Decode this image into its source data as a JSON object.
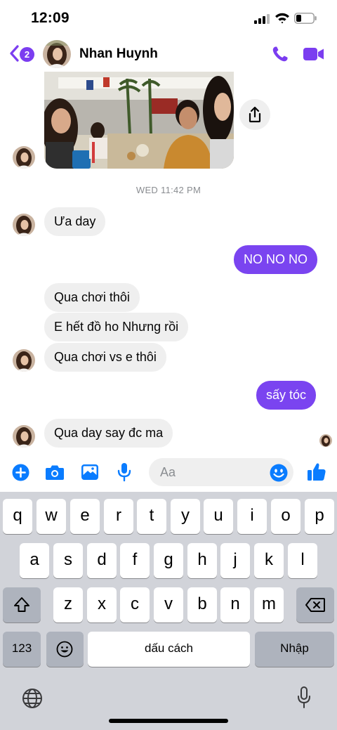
{
  "status_bar": {
    "time": "12:09"
  },
  "header": {
    "unread_count": "2",
    "contact_name": "Nhan Huynh"
  },
  "conversation": {
    "timestamp": "WED 11:42 PM",
    "messages": [
      {
        "sender": "contact",
        "text": "Ưa day"
      },
      {
        "sender": "me",
        "text": "NO NO NO"
      },
      {
        "sender": "contact",
        "text": "Qua chơi thôi"
      },
      {
        "sender": "contact",
        "text": "E hết đồ ho Nhưng rồi"
      },
      {
        "sender": "contact",
        "text": "Qua chơi vs e thôi"
      },
      {
        "sender": "me",
        "text": "sấy tóc"
      },
      {
        "sender": "contact",
        "text": "Qua day say đc ma"
      }
    ]
  },
  "composer": {
    "placeholder": "Aa"
  },
  "keyboard": {
    "row1": [
      "q",
      "w",
      "e",
      "r",
      "t",
      "y",
      "u",
      "i",
      "o",
      "p"
    ],
    "row2": [
      "a",
      "s",
      "d",
      "f",
      "g",
      "h",
      "j",
      "k",
      "l"
    ],
    "row3": [
      "z",
      "x",
      "c",
      "v",
      "b",
      "n",
      "m"
    ],
    "numbers_label": "123",
    "space_label": "dấu cách",
    "return_label": "Nhập"
  },
  "colors": {
    "accent": "#7a44f0",
    "incoming_bubble": "#efefef",
    "composer_icon": "#0a7cff"
  },
  "icons": [
    "back-chevron-icon",
    "phone-icon",
    "video-camera-icon",
    "share-icon",
    "plus-icon",
    "camera-icon",
    "image-icon",
    "microphone-icon",
    "emoji-icon",
    "thumbs-up-icon",
    "shift-icon",
    "backspace-icon",
    "globe-icon",
    "dictation-icon",
    "signal-icon",
    "wifi-icon",
    "battery-icon"
  ]
}
